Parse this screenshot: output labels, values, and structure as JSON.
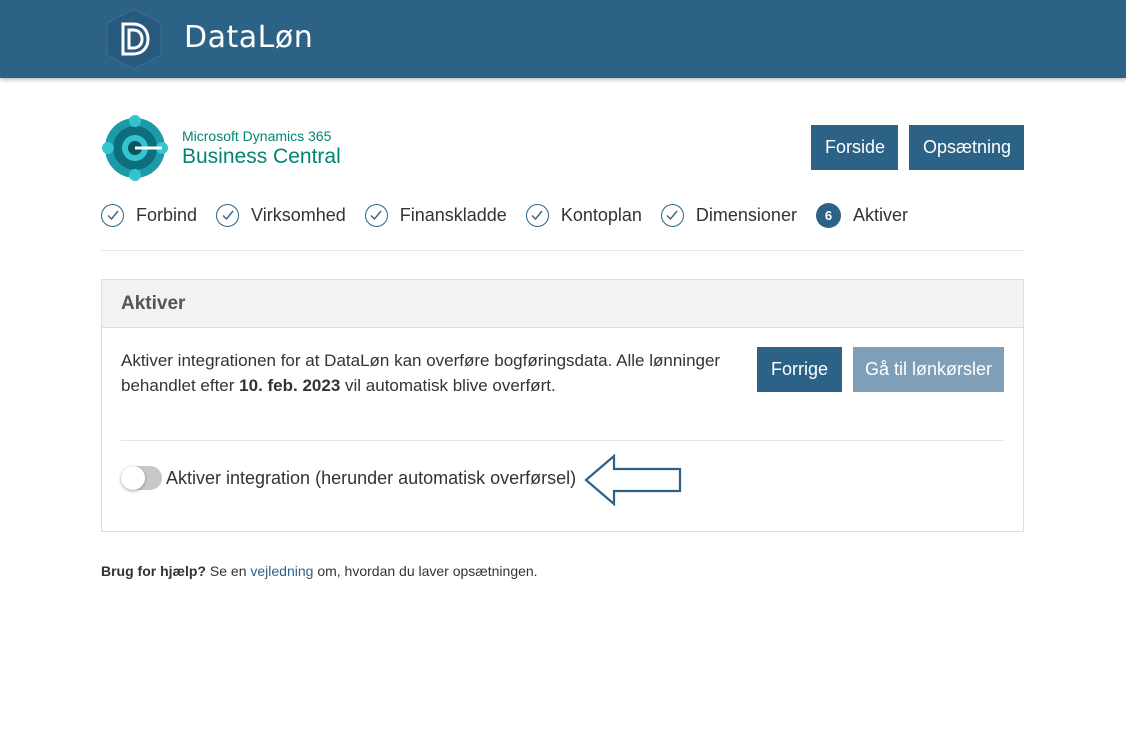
{
  "app": {
    "brand_name": "DataLøn"
  },
  "integration": {
    "vendor_line": "Microsoft Dynamics 365",
    "product_line": "Business Central"
  },
  "header_buttons": {
    "forside": "Forside",
    "opsaetning": "Opsætning"
  },
  "steps": [
    {
      "label": "Forbind",
      "state": "done"
    },
    {
      "label": "Virksomhed",
      "state": "done"
    },
    {
      "label": "Finanskladde",
      "state": "done"
    },
    {
      "label": "Kontoplan",
      "state": "done"
    },
    {
      "label": "Dimensioner",
      "state": "done"
    },
    {
      "label": "Aktiver",
      "state": "current",
      "number": "6"
    }
  ],
  "panel": {
    "title": "Aktiver",
    "description_before": "Aktiver integrationen for at DataLøn kan overføre bogføringsdata. Alle lønninger behandlet efter ",
    "description_date": "10. feb. 2023",
    "description_after": " vil automatisk blive overført.",
    "btn_previous": "Forrige",
    "btn_payroll": "Gå til lønkørsler",
    "toggle_label": "Aktiver integration (herunder automatisk overførsel)",
    "toggle_on": false
  },
  "help": {
    "bold": "Brug for hjælp?",
    "text_before": " Se en ",
    "link": "vejledning",
    "text_after": " om, hvordan du laver opsætningen."
  },
  "colors": {
    "brand": "#2d6287",
    "button_disabled": "#7f9fb8",
    "bc_teal": "#008575",
    "header_bg": "#2d6287"
  },
  "icons": {
    "app_logo": "dataloen-logo-icon",
    "bc_logo": "business-central-logo-icon",
    "step_done": "checkmark-icon",
    "annotation": "arrow-left-icon"
  }
}
